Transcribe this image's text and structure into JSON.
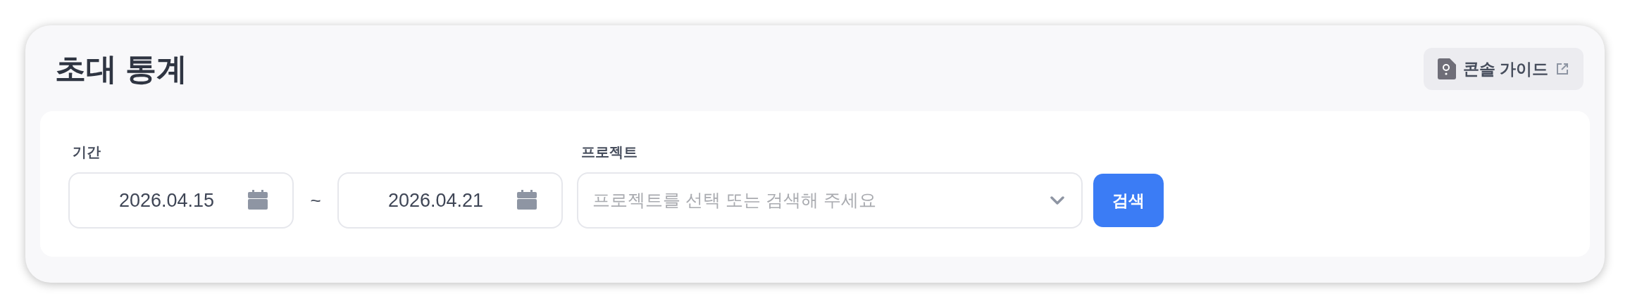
{
  "header": {
    "title": "초대 통계",
    "guide_button": "콘솔 가이드"
  },
  "filters": {
    "period": {
      "label": "기간",
      "start": "2026.04.15",
      "separator": "~",
      "end": "2026.04.21"
    },
    "project": {
      "label": "프로젝트",
      "placeholder": "프로젝트를 선택 또는 검색해 주세요"
    },
    "search_button": "검색"
  }
}
